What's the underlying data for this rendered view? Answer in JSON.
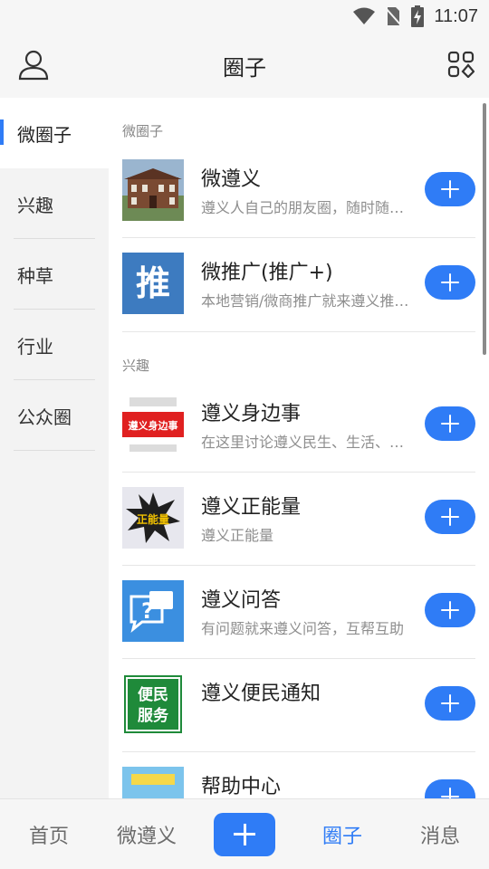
{
  "status_bar": {
    "time": "11:07"
  },
  "header": {
    "title": "圈子"
  },
  "sidebar": {
    "items": [
      {
        "label": "微圈子"
      },
      {
        "label": "兴趣"
      },
      {
        "label": "种草"
      },
      {
        "label": "行业"
      },
      {
        "label": "公众圈"
      }
    ]
  },
  "content": {
    "sections": [
      {
        "title": "微圈子",
        "items": [
          {
            "title": "微遵义",
            "desc": "遵义人自己的朋友圈，随时随地分享生活"
          },
          {
            "title": "微推广(推广+)",
            "desc": "本地营销/微商推广就来遵义推广圈"
          }
        ]
      },
      {
        "title": "兴趣",
        "items": [
          {
            "title": "遵义身边事",
            "desc": "在这里讨论遵义民生、生活、身边事"
          },
          {
            "title": "遵义正能量",
            "desc": "遵义正能量"
          },
          {
            "title": "遵义问答",
            "desc": "有问题就来遵义问答，互帮互助"
          },
          {
            "title": "遵义便民通知",
            "desc": ""
          },
          {
            "title": "帮助中心",
            "desc": ""
          }
        ]
      }
    ],
    "thumb_text": {
      "tui": "推",
      "shenbian": "遵义身边事",
      "zheng": "正能量",
      "wenda": "?",
      "bianmin_1": "便民",
      "bianmin_2": "服务"
    }
  },
  "bottom_nav": {
    "items": [
      {
        "label": "首页"
      },
      {
        "label": "微遵义"
      },
      {
        "label": "圈子"
      },
      {
        "label": "消息"
      }
    ]
  },
  "colors": {
    "accent": "#2f7cf6",
    "sidebar_bg": "#f3f3f3",
    "header_bg": "#f6f6f6"
  }
}
